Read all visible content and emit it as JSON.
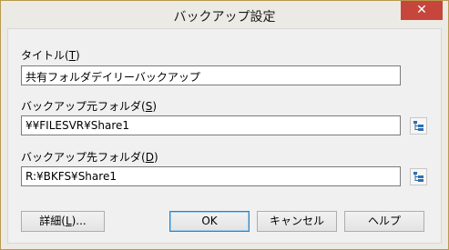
{
  "window": {
    "title": "バックアップ設定",
    "close_label": "✕"
  },
  "form": {
    "title_label": "タイトル(",
    "title_key": "T",
    "title_label_end": ")",
    "title_value": "共有フォルダデイリーバックアップ",
    "source_label": "バックアップ元フォルダ(",
    "source_key": "S",
    "source_label_end": ")",
    "source_value": "¥¥FILESVR¥Share1",
    "dest_label": "バックアップ先フォルダ(",
    "dest_key": "D",
    "dest_label_end": ")",
    "dest_value": "R:¥BKFS¥Share1"
  },
  "buttons": {
    "details_prefix": "詳細(",
    "details_key": "L",
    "details_suffix": ")...",
    "ok": "OK",
    "cancel": "キャンセル",
    "help": "ヘルプ"
  },
  "icons": {
    "browse": "folder-tree-icon"
  }
}
